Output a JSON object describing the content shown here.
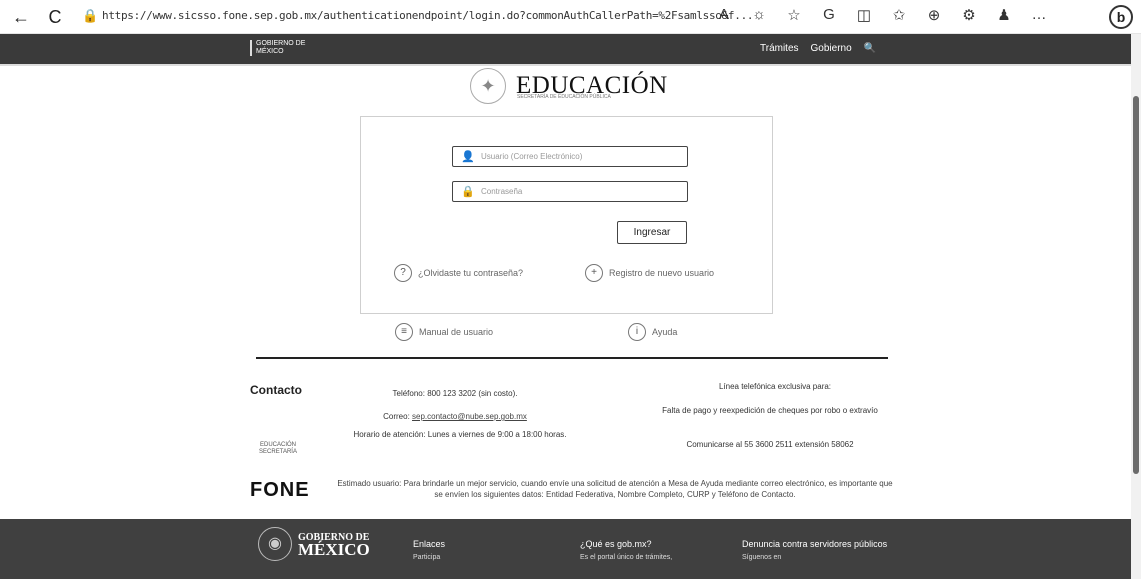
{
  "browser": {
    "back": "←",
    "reload": "C",
    "lock": "🔒",
    "url": "https://www.sicsso.fone.sep.gob.mx/authenticationendpoint/login.do?commonAuthCallerPath=%2Fsamlsso&f...",
    "icons": [
      "A",
      "☼",
      "☆",
      "G",
      "◫",
      "✩",
      "⊕",
      "⚙",
      "♟",
      "…"
    ],
    "profile": "b"
  },
  "gob_header": {
    "logo_line1": "GOBIERNO DE",
    "logo_line2": "MÉXICO",
    "links": [
      "Trámites",
      "Gobierno",
      "🔍"
    ]
  },
  "brand": {
    "title": "EDUCACIÓN",
    "subtitle": "SECRETARÍA DE EDUCACIÓN PÚBLICA"
  },
  "login": {
    "user_placeholder": "Usuario (Correo Electrónico)",
    "password_placeholder": "Contraseña",
    "submit_label": "Ingresar",
    "forgot_label": "¿Olvidaste tu contraseña?",
    "register_label": "Registro de nuevo usuario",
    "manual_label": "Manual de usuario",
    "help_label": "Ayuda"
  },
  "contact": {
    "title": "Contacto",
    "phone": "Teléfono: 800 123 3202 (sin costo).",
    "email_prefix": "Correo: ",
    "email": "sep.contacto@nube.sep.gob.mx",
    "hours": "Horario de atención: Lunes a viernes de 9:00 a 18:00 horas.",
    "side_title": "Línea telefónica exclusiva para:",
    "side_body": "Falta de pago y reexpedición de cheques por robo o extravío",
    "side_phone": "Comunicarse al 55 3600 2511 extensión 58062",
    "small_logo": "EDUCACIÓN SECRETARÍA"
  },
  "fone_notice": {
    "logo": "FONE",
    "text": "Estimado usuario: Para brindarle un mejor servicio, cuando envíe una solicitud de atención a Mesa de Ayuda mediante correo electrónico, es importante que se envíen los siguientes datos: Entidad Federativa, Nombre Completo, CURP y Teléfono de Contacto."
  },
  "footer": {
    "logo_small": "GOBIERNO DE",
    "logo_big": "MÉXICO",
    "col1_title": "Enlaces",
    "col1_sub": "Participa",
    "col2_title": "¿Qué es gob.mx?",
    "col2_sub": "Es el portal único de trámites,",
    "col3_title": "Denuncia contra servidores públicos",
    "col3_sub": "Síguenos en"
  }
}
